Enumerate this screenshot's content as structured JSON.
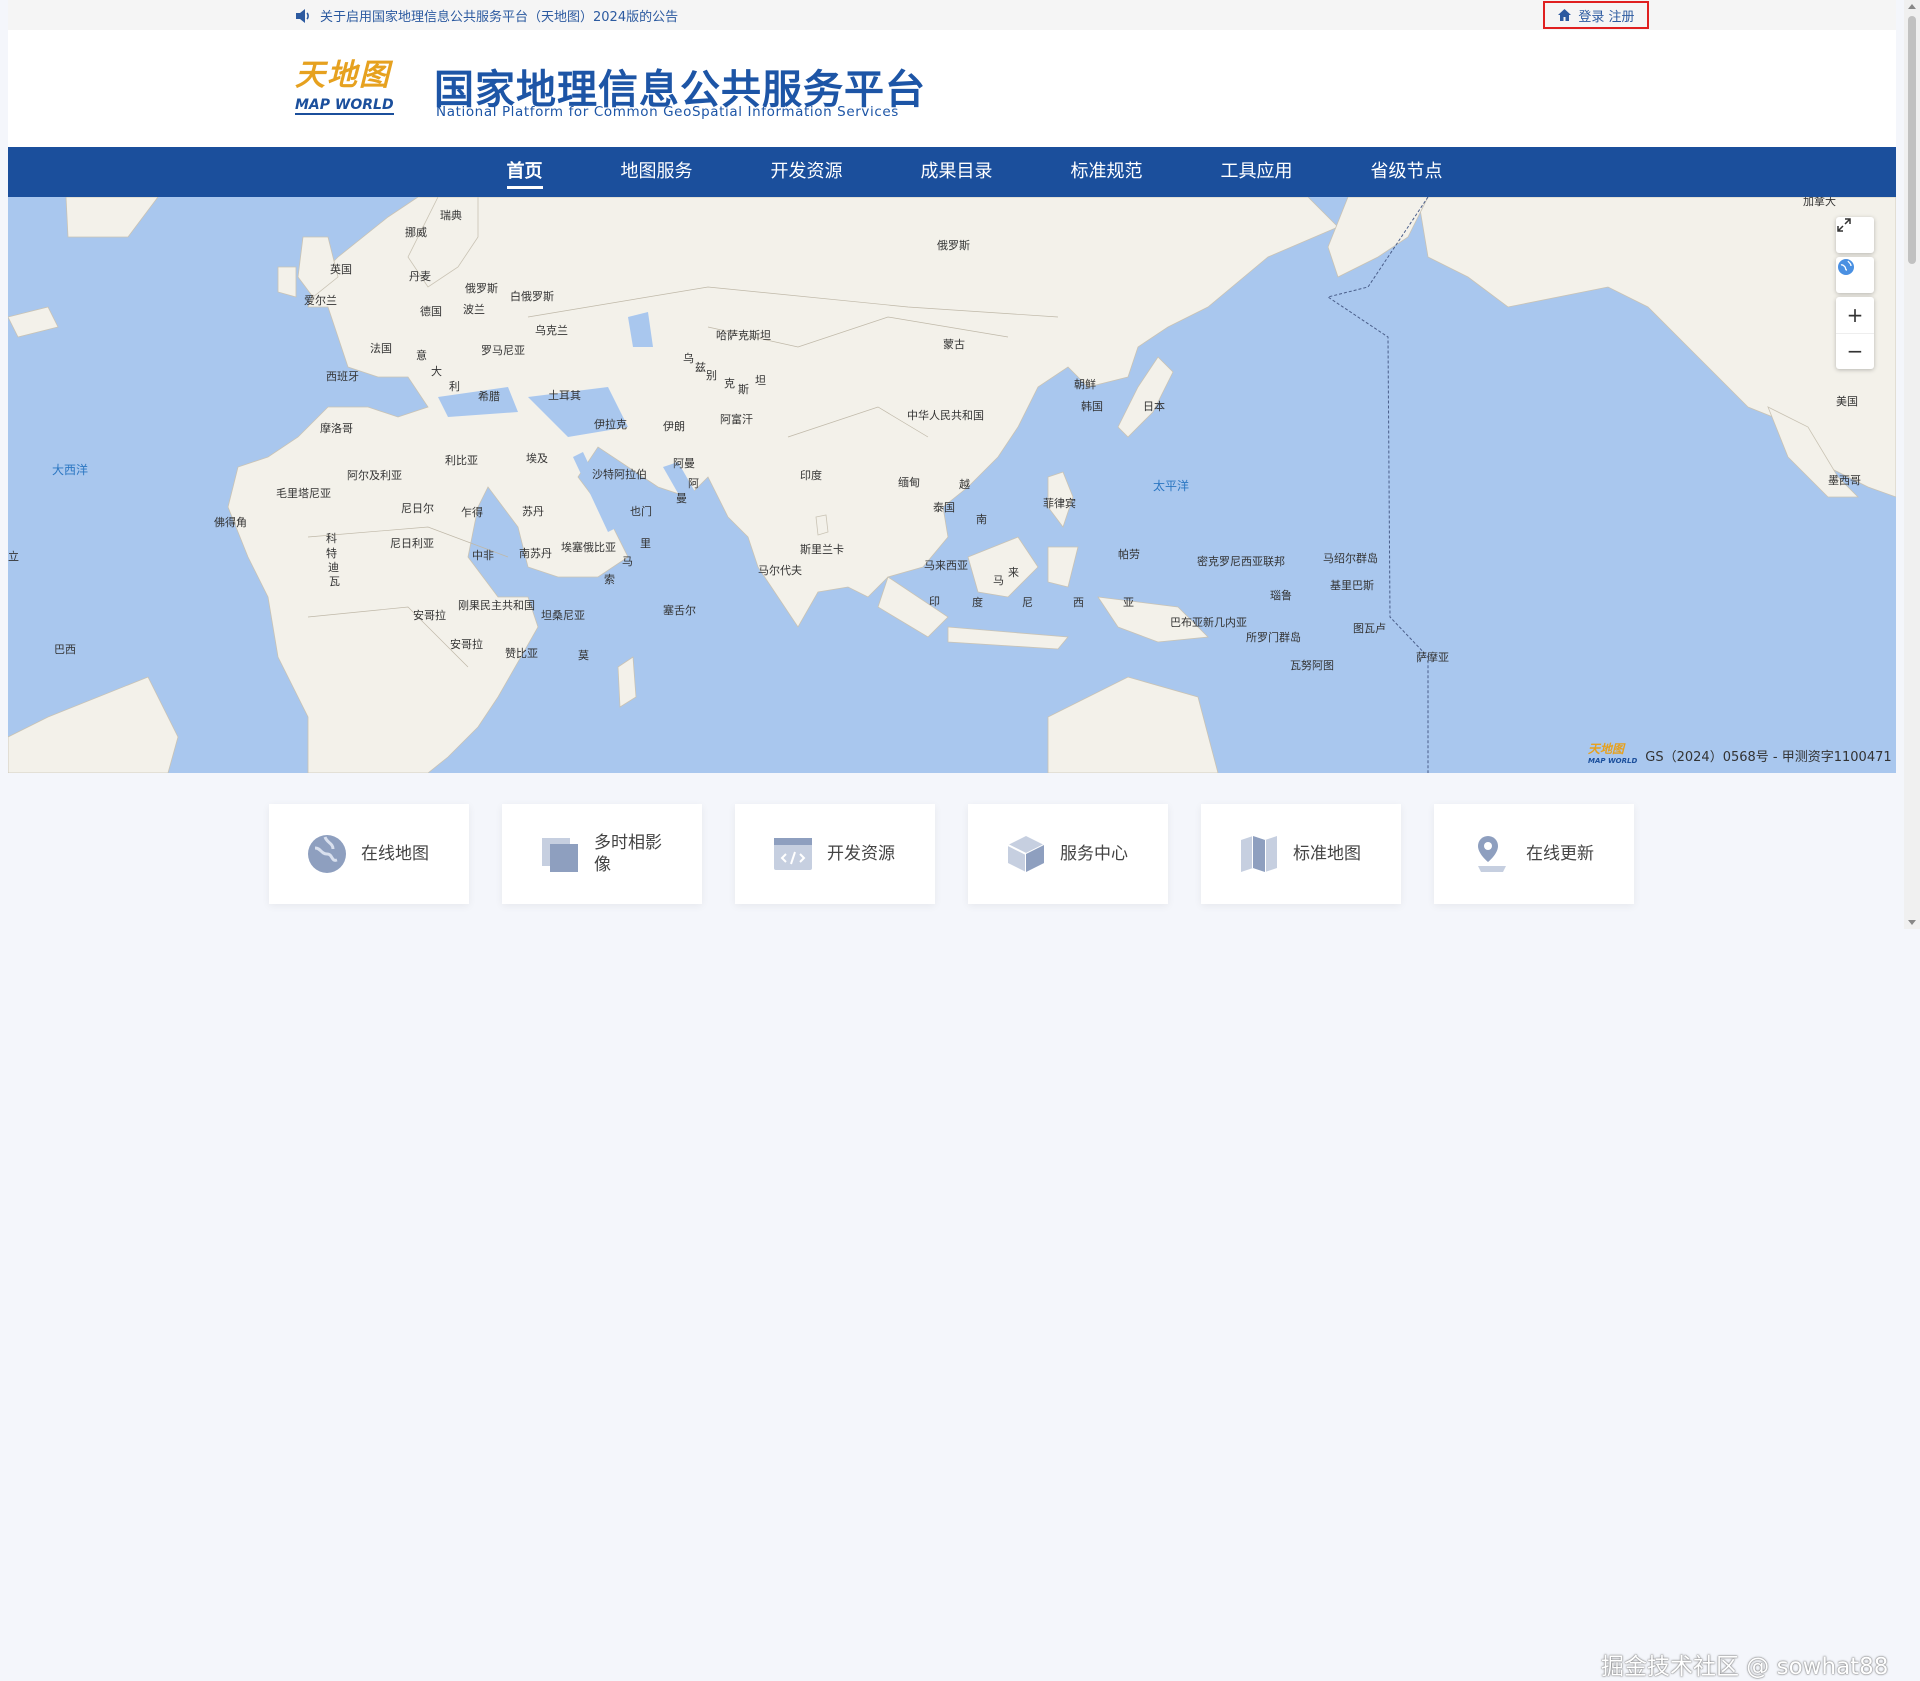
{
  "topbar": {
    "notice": "关于启用国家地理信息公共服务平台（天地图）2024版的公告",
    "login_label": "登录 注册"
  },
  "header": {
    "logo_cn": "天地图",
    "logo_en": "MAP WORLD",
    "title_cn": "国家地理信息公共服务平台",
    "title_en": "National Platform for Common GeoSpatial Information Services"
  },
  "nav": {
    "items": [
      "首页",
      "地图服务",
      "开发资源",
      "成果目录",
      "标准规范",
      "工具应用",
      "省级节点"
    ],
    "active_index": 0
  },
  "map": {
    "labels": {
      "sweden": "瑞典",
      "norway": "挪威",
      "uk": "英国",
      "denmark": "丹麦",
      "ireland": "爱尔兰",
      "russia_w": "俄罗斯",
      "belarus": "白俄罗斯",
      "germany": "德国",
      "poland": "波兰",
      "ukraine": "乌克兰",
      "france": "法国",
      "romania": "罗马尼亚",
      "italy1": "意",
      "italy2": "大",
      "italy3": "利",
      "spain": "西班牙",
      "greece": "希腊",
      "turkey": "土耳其",
      "kazakhstan": "哈萨克斯坦",
      "uzbek1": "乌",
      "uzbek2": "兹",
      "uzbek3": "别",
      "uzbek4": "克",
      "uzbek5": "斯",
      "uzbek6": "坦",
      "russia": "俄罗斯",
      "mongolia": "蒙古",
      "dprk": "朝鲜",
      "rok": "韩国",
      "japan": "日本",
      "china": "中华人民共和国",
      "iraq": "伊拉克",
      "iran": "伊朗",
      "afghan": "阿富汗",
      "morocco": "摩洛哥",
      "algeria": "阿尔及利亚",
      "libya": "利比亚",
      "egypt": "埃及",
      "saudi": "沙特阿拉伯",
      "oman1": "阿曼",
      "oman2": "阿",
      "oman3": "曼",
      "yemen": "也门",
      "india": "印度",
      "myanmar": "缅甸",
      "vietnam": "越",
      "thailand": "泰国",
      "laos": "南",
      "philippines": "菲律宾",
      "mauritania": "毛里塔尼亚",
      "mali": "尼日尔",
      "chad": "乍得",
      "sudan": "苏丹",
      "nigeria": "尼日利亚",
      "ssudan": "南苏丹",
      "ethiopia": "埃塞俄比亚",
      "somalia1": "里",
      "somalia2": "马",
      "somalia3": "索",
      "car": "中非",
      "cote1": "科",
      "cote2": "特",
      "cote3": "迪",
      "cote4": "瓦",
      "drc": "刚果民主共和国",
      "tanzania": "坦桑尼亚",
      "angola": "安哥拉",
      "angola2": "安哥拉",
      "zambia": "赞比亚",
      "mozam": "莫",
      "seychelles": "塞舌尔",
      "srilanka": "斯里兰卡",
      "maldives": "马尔代夫",
      "malaysia": "马来西亚",
      "malaysia2": "马",
      "malaysia3": "来",
      "indo1": "印",
      "indo2": "度",
      "indo3": "尼",
      "indo4": "西",
      "indo5": "亚",
      "palau": "帕劳",
      "micronesia": "密克罗尼西亚联邦",
      "marshall": "马绍尔群岛",
      "nauru": "瑙鲁",
      "kiribati": "基里巴斯",
      "png": "巴布亚新几内亚",
      "solomon": "所罗门群岛",
      "tuvalu": "图瓦卢",
      "vanuatu": "瓦努阿图",
      "samoa": "萨摩亚",
      "brazil": "巴西",
      "usa": "美国",
      "mexico": "墨西哥",
      "canada": "加拿大",
      "cape": "佛得角",
      "liberia": "立",
      "atlantic": "大西洋",
      "pacific": "太平洋"
    },
    "controls": [
      "fullscreen",
      "globe",
      "+",
      "−"
    ],
    "copyright": "GS（2024）0568号 - 甲测资字1100471"
  },
  "cards": [
    {
      "label": "在线地图",
      "icon": "globe-icon"
    },
    {
      "label": "多时相影像",
      "icon": "layers-icon"
    },
    {
      "label": "开发资源",
      "icon": "code-window-icon"
    },
    {
      "label": "服务中心",
      "icon": "box-icon"
    },
    {
      "label": "标准地图",
      "icon": "map-icon"
    },
    {
      "label": "在线更新",
      "icon": "location-pin-icon"
    }
  ],
  "watermark": "掘金技术社区 @ sowhat88",
  "colors": {
    "brand_blue": "#1b4f9c",
    "ocean": "#a9c7ee",
    "land": "#f3f1ea",
    "logo_orange": "#e6a11f",
    "highlight_red": "#e02020"
  }
}
